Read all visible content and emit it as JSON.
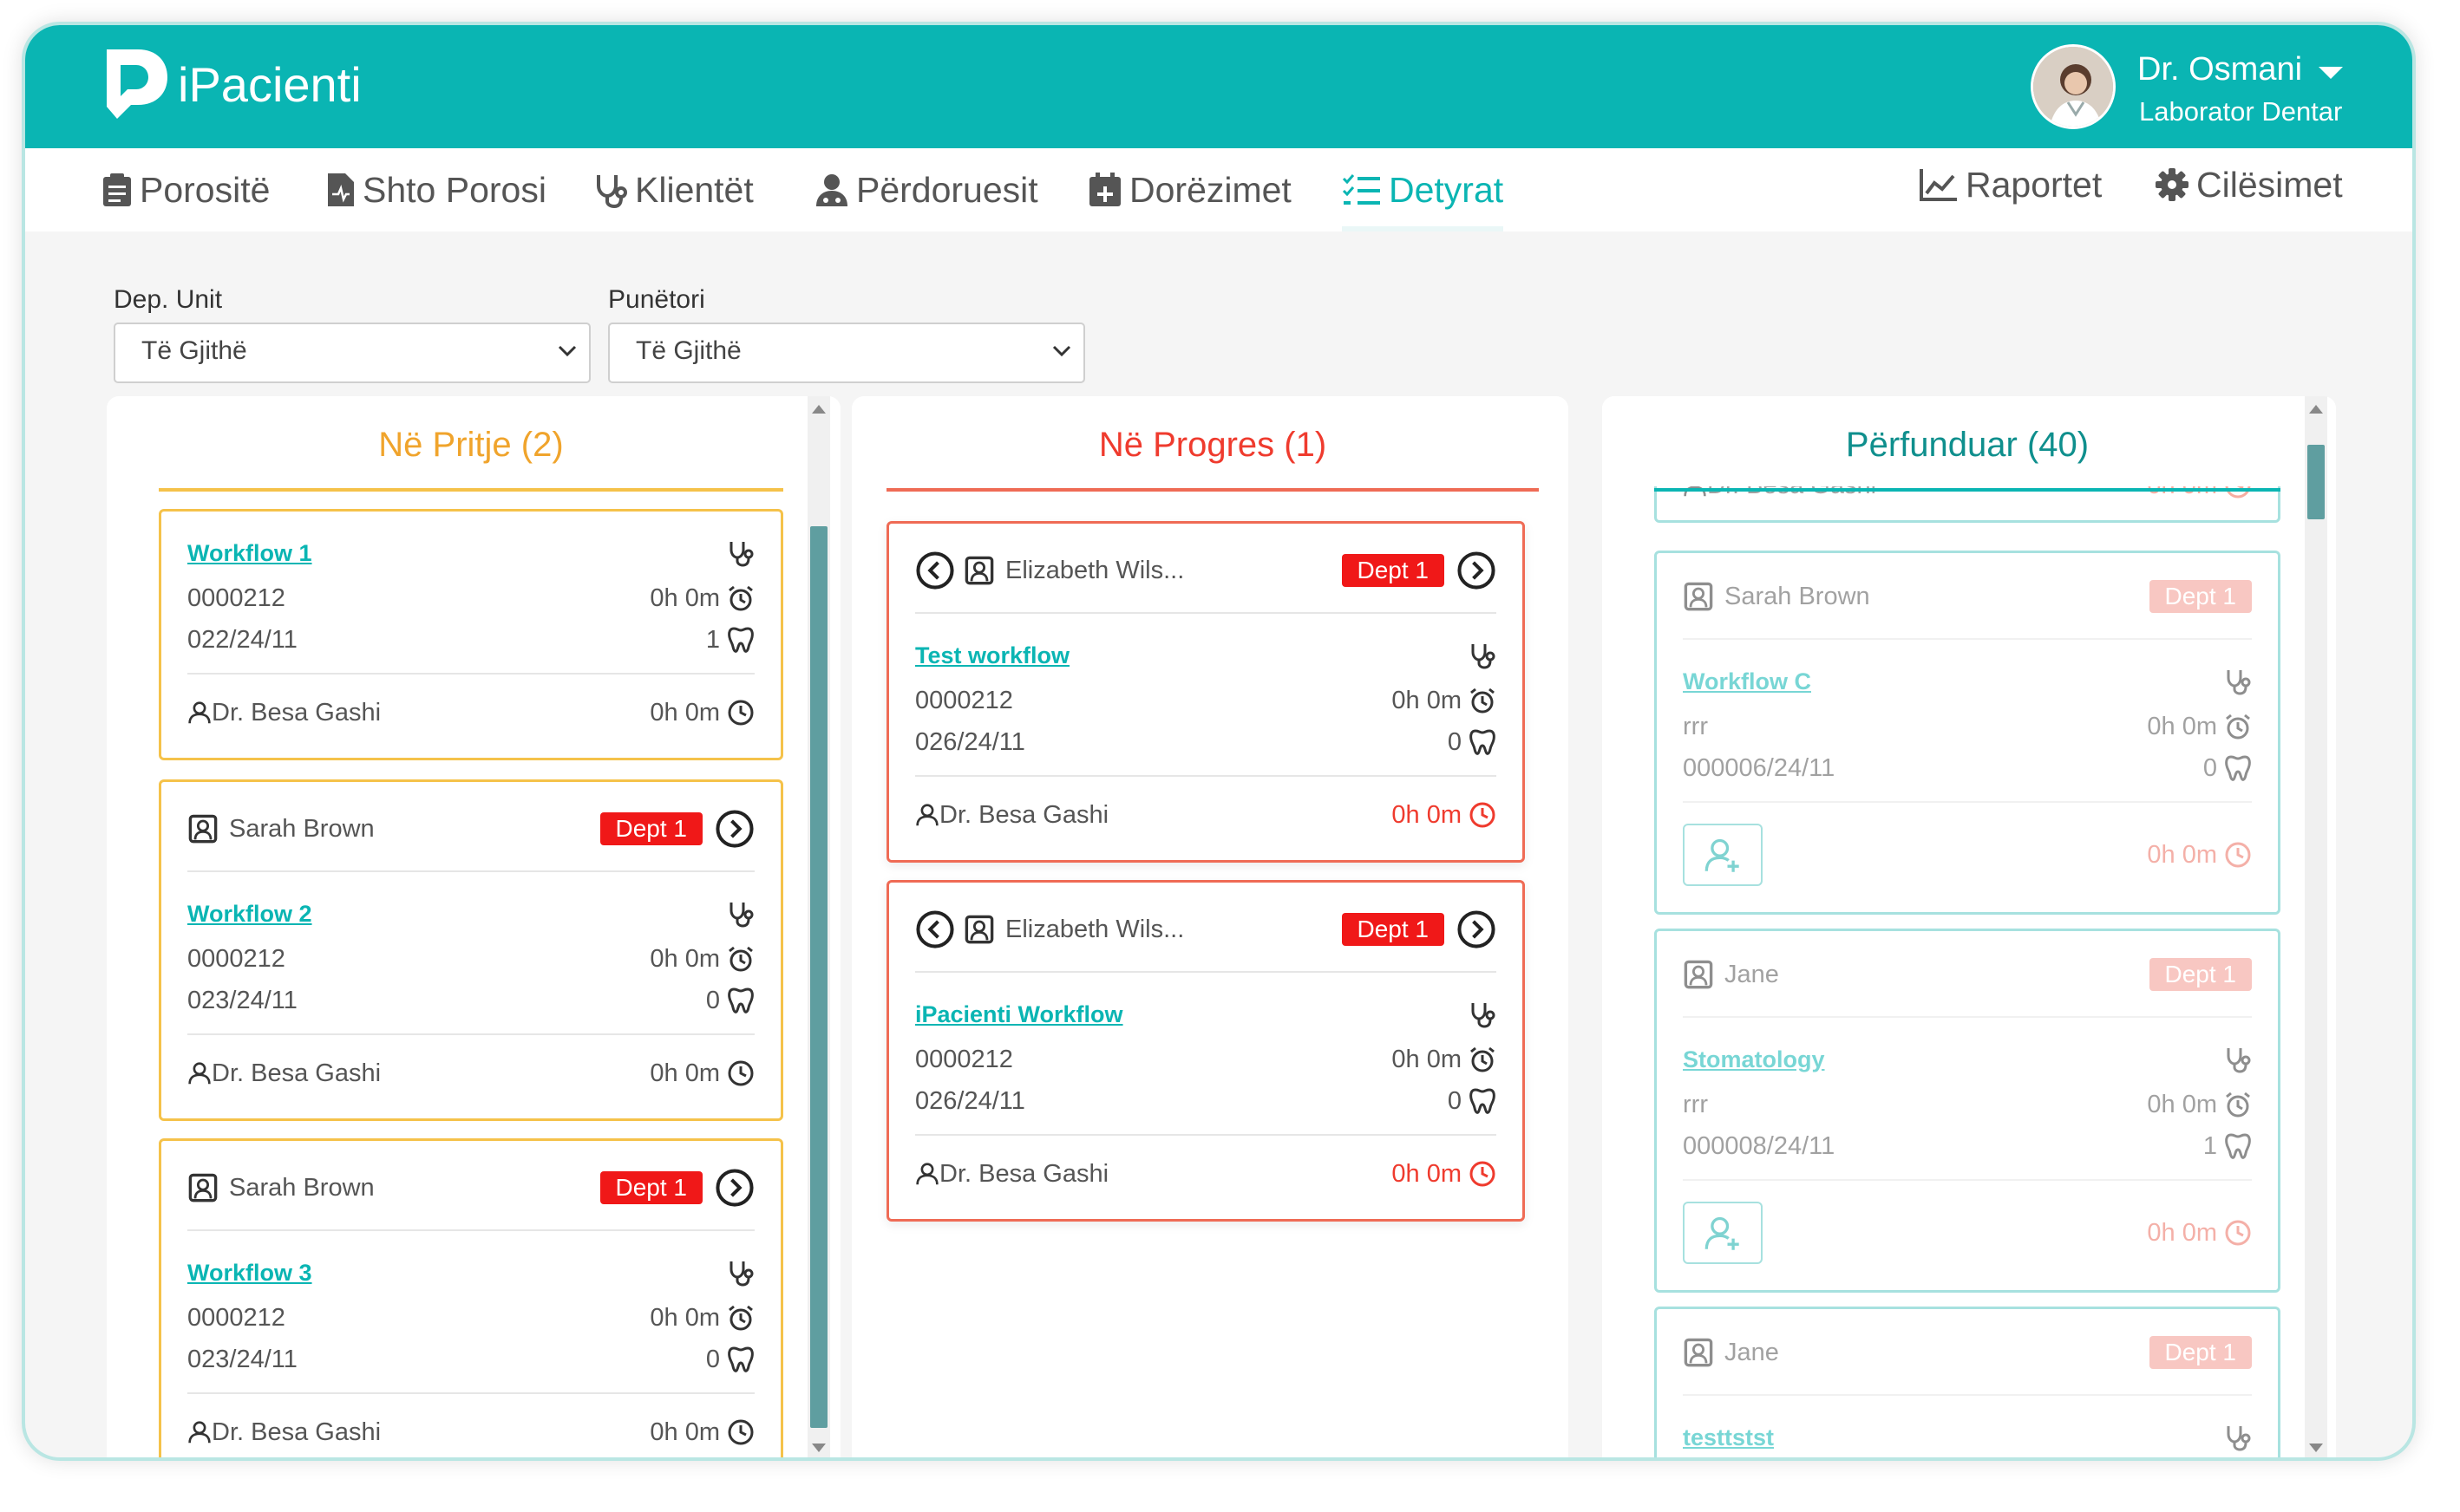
{
  "app": {
    "title": "iPacienti"
  },
  "user": {
    "name": "Dr. Osmani",
    "role": "Laborator Dentar"
  },
  "nav": {
    "items": [
      {
        "label": "Porositë",
        "icon": "clipboard-icon"
      },
      {
        "label": "Shto Porosi",
        "icon": "add-file-icon"
      },
      {
        "label": "Klientët",
        "icon": "stethoscope-icon"
      },
      {
        "label": "Përdoruesit",
        "icon": "user-icon"
      },
      {
        "label": "Dorëzimet",
        "icon": "calendar-plus-icon"
      },
      {
        "label": "Detyrat",
        "icon": "task-list-icon",
        "active": true
      }
    ],
    "right_items": [
      {
        "label": "Raportet",
        "icon": "chart-icon"
      },
      {
        "label": "Cilësimet",
        "icon": "gear-icon"
      }
    ]
  },
  "filters": {
    "dep_unit": {
      "label": "Dep. Unit",
      "value": "Të Gjithë"
    },
    "worker": {
      "label": "Punëtori",
      "value": "Të Gjithë"
    }
  },
  "columns": {
    "pending": {
      "title": "Në Pritje (2)",
      "cards": [
        {
          "workflow": "Workflow 1",
          "code": "0000212",
          "order": "022/24/11",
          "time": "0h 0m",
          "count": "1",
          "doctor": "Dr. Besa Gashi",
          "elapsed": "0h 0m"
        },
        {
          "patient": "Sarah Brown",
          "dept": "Dept 1",
          "workflow": "Workflow 2",
          "code": "0000212",
          "order": "023/24/11",
          "time": "0h 0m",
          "count": "0",
          "doctor": "Dr. Besa Gashi",
          "elapsed": "0h 0m"
        },
        {
          "patient": "Sarah Brown",
          "dept": "Dept 1",
          "workflow": "Workflow 3",
          "code": "0000212",
          "order": "023/24/11",
          "time": "0h 0m",
          "count": "0",
          "doctor": "Dr. Besa Gashi",
          "elapsed": "0h 0m"
        }
      ]
    },
    "in_progress": {
      "title": "Në Progres (1)",
      "cards": [
        {
          "patient": "Elizabeth Wils...",
          "dept": "Dept 1",
          "workflow": "Test workflow",
          "code": "0000212",
          "order": "026/24/11",
          "time": "0h 0m",
          "count": "0",
          "doctor": "Dr. Besa Gashi",
          "elapsed": "0h 0m"
        },
        {
          "patient": "Elizabeth Wils...",
          "dept": "Dept 1",
          "workflow": "iPacienti Workflow",
          "code": "0000212",
          "order": "026/24/11",
          "time": "0h 0m",
          "count": "0",
          "doctor": "Dr. Besa Gashi",
          "elapsed": "0h 0m"
        }
      ]
    },
    "done": {
      "title": "Përfunduar (40)",
      "partial": {
        "doctor": "Dr. Besa Gashi",
        "elapsed": "0h 0m"
      },
      "cards": [
        {
          "patient": "Sarah Brown",
          "dept": "Dept 1",
          "workflow": "Workflow C",
          "code": "rrr",
          "order": "000006/24/11",
          "time": "0h 0m",
          "count": "0",
          "elapsed": "0h 0m"
        },
        {
          "patient": "Jane",
          "dept": "Dept 1",
          "workflow": "Stomatology",
          "code": "rrr",
          "order": "000008/24/11",
          "time": "0h 0m",
          "count": "1",
          "elapsed": "0h 0m"
        },
        {
          "patient": "Jane",
          "dept": "Dept 1",
          "workflow": "testtstst"
        }
      ]
    }
  },
  "colors": {
    "brand": "#0ab5b3",
    "pending": "#f5c24a",
    "pending_title": "#f0a42c",
    "progress": "#ef6b55",
    "badge": "#f01818"
  }
}
